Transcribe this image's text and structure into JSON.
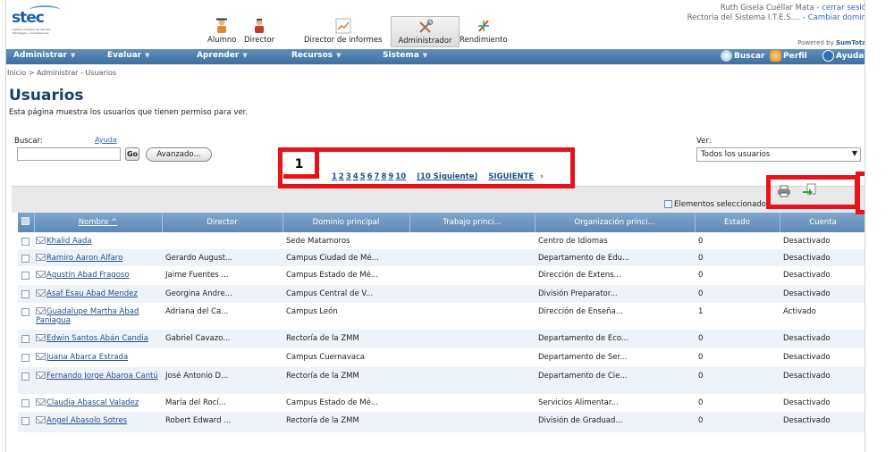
{
  "header": {
    "logo_text": "stec",
    "logo_subtitle": "Sistema Integral del Talento, Estrategia y Competencias",
    "roles": [
      "Alumno",
      "Director",
      "Director de informes",
      "Administrador",
      "Rendimiento"
    ],
    "active_role": "Administrador",
    "user_name": "Ruth Gisela Cuéllar Mata",
    "logout_link": "- cerrar sesió",
    "domain": "Rectoría del Sistema I.T.E.S.... -",
    "change_domain_link": "Cambiar domin",
    "powered_by": "Powered by",
    "powered_brand": "SumTota"
  },
  "nav": {
    "menus": [
      "Administrar",
      "Evaluar",
      "Aprender",
      "Recursos",
      "Sistema"
    ],
    "search_label": "Buscar",
    "profile_label": "Perfil",
    "help_label": "Ayuda"
  },
  "breadcrumb": "Inicio > Administrar - Usuarios",
  "page": {
    "title": "Usuarios",
    "description": "Esta página muestra los usuarios que tienen permiso para ver."
  },
  "search": {
    "label": "Buscar:",
    "help_link": "Ayuda",
    "value": "",
    "go_label": "Go",
    "advanced_label": "Avanzado..."
  },
  "view": {
    "label": "Ver:",
    "selected": "Todos los usuarios"
  },
  "pager": {
    "pages": [
      "1",
      "2",
      "3",
      "4",
      "5",
      "6",
      "7",
      "8",
      "9",
      "10"
    ],
    "next_ten": "(10 Siguiente)",
    "next": "SIGUIENTE"
  },
  "annotation": {
    "callout_number": "1"
  },
  "selected_items_label": "Elementos seleccionado",
  "table": {
    "columns": [
      "Nombre ^",
      "Director",
      "Dominio principal",
      "Trabajo princi...",
      "Organización princi...",
      "Estado",
      "Cuenta"
    ],
    "rows": [
      {
        "name": "Khalid Aada",
        "director": "",
        "domain": "Sede Matamoros",
        "job": "",
        "org": "Centro de Idiomas",
        "state": "0",
        "account": "Desactivado"
      },
      {
        "name": "Ramiro Aaron Alfaro",
        "director": "Gerardo August...",
        "domain": "Campus Ciudad de Mé...",
        "job": "",
        "org": "Departamento de Edu...",
        "state": "0",
        "account": "Desactivado"
      },
      {
        "name": "Agustín Abad Fragoso",
        "director": "Jaime Fuentes ...",
        "domain": "Campus Estado de Mé...",
        "job": "",
        "org": "Dirección de Extens...",
        "state": "0",
        "account": "Desactivado"
      },
      {
        "name": "Asaf Esau Abad Mendez",
        "director": "Georgina Andre...",
        "domain": "Campus Central de V...",
        "job": "",
        "org": "División Preparator...",
        "state": "0",
        "account": "Desactivado"
      },
      {
        "name": "Guadalupe Martha Abad Paniagua",
        "director": "Adriana del Ca...",
        "domain": "Campus León",
        "job": "",
        "org": "Dirección de Enseña...",
        "state": "1",
        "account": "Activado"
      },
      {
        "name": "Edwin Santos Abán Candia",
        "director": "Gabriel Cavazo...",
        "domain": "Rectoría de la ZMM",
        "job": "",
        "org": "Departamento de Eco...",
        "state": "0",
        "account": "Desactivado"
      },
      {
        "name": "Juana Abarca Estrada",
        "director": "",
        "domain": "Campus Cuernavaca",
        "job": "",
        "org": "Departamento de Ser...",
        "state": "0",
        "account": "Desactivado"
      },
      {
        "name": "Fernando Jorge Abaroa Cantú",
        "director": "José Antonio D...",
        "domain": "Rectoría de la ZMM",
        "job": "",
        "org": "Departamento de Cie...",
        "state": "0",
        "account": "Desactivado"
      },
      {
        "name": "Claudia Abascal Valadez",
        "director": "María del Rocí...",
        "domain": "Campus Estado de Mé...",
        "job": "",
        "org": "Servicios Alimentar...",
        "state": "0",
        "account": "Desactivado"
      },
      {
        "name": "Angel Abasolo Sotres",
        "director": "Robert Edward ...",
        "domain": "Rectoría de la ZMM",
        "job": "",
        "org": "División de Graduad...",
        "state": "0",
        "account": "Desactivado"
      }
    ]
  }
}
